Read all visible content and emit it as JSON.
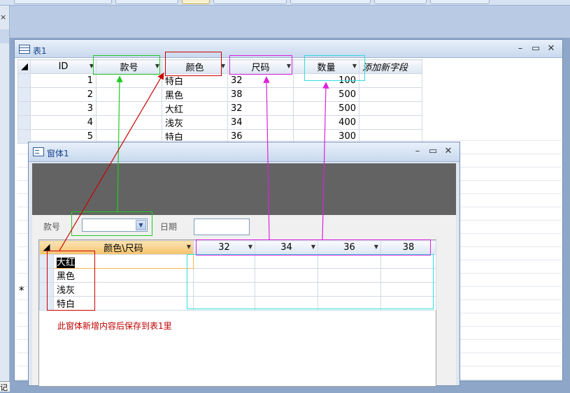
{
  "colors": {
    "green": "#22cc22",
    "red": "#cc0000",
    "magenta": "#dd22dd",
    "cyan": "#33dddd",
    "accent": "#15428b"
  },
  "table_window": {
    "title": "表1",
    "columns": [
      "ID",
      "款号",
      "颜色",
      "尺码",
      "数量",
      "添加新字段"
    ],
    "rows": [
      {
        "id": "1",
        "code": "",
        "color": "特白",
        "size": "32",
        "qty": "100"
      },
      {
        "id": "2",
        "code": "",
        "color": "黑色",
        "size": "38",
        "qty": "500"
      },
      {
        "id": "3",
        "code": "",
        "color": "大红",
        "size": "32",
        "qty": "500"
      },
      {
        "id": "4",
        "code": "",
        "color": "浅灰",
        "size": "34",
        "qty": "400"
      },
      {
        "id": "5",
        "code": "",
        "color": "特白",
        "size": "36",
        "qty": "300"
      }
    ],
    "new_record_marker": "*",
    "controls": {
      "minimize": "–",
      "restore": "▭",
      "close": "✕"
    }
  },
  "form_window": {
    "title": "窗体1",
    "code_label": "款号",
    "date_label": "日期",
    "code_value": "",
    "date_value": "",
    "subform": {
      "header_label": "颜色\\尺码",
      "sizes": [
        "32",
        "34",
        "36",
        "38"
      ],
      "colors": [
        "大红",
        "黑色",
        "浅灰",
        "特白"
      ]
    },
    "note": "此窗体新增内容后保存到表1里",
    "controls": {
      "minimize": "–",
      "restore": "▭",
      "close": "✕"
    }
  },
  "left_pane": {
    "close_glyph": "×",
    "bottom_text": "记"
  },
  "icons": [
    "table-icon",
    "form-icon",
    "dropdown-arrow-icon",
    "select-all-icon"
  ]
}
